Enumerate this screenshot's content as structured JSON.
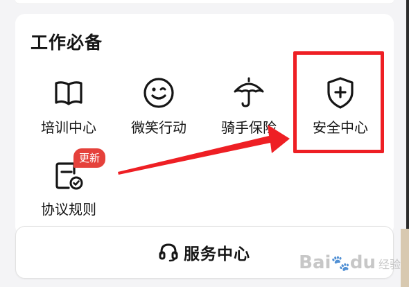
{
  "section": {
    "title": "工作必备"
  },
  "tools": [
    {
      "label": "培训中心",
      "icon": "book-icon"
    },
    {
      "label": "微笑行动",
      "icon": "smile-icon"
    },
    {
      "label": "骑手保险",
      "icon": "umbrella-icon"
    },
    {
      "label": "安全中心",
      "icon": "shield-plus-icon"
    },
    {
      "label": "协议规则",
      "icon": "document-check-icon",
      "badge": "更新"
    }
  ],
  "service": {
    "label": "服务中心",
    "icon": "headset-icon"
  },
  "watermark": {
    "brand": "Bai",
    "brand_tail": "du",
    "sub": "经验"
  },
  "colors": {
    "highlight": "#ee1f24",
    "badge": "#e5413b",
    "text": "#151515"
  }
}
